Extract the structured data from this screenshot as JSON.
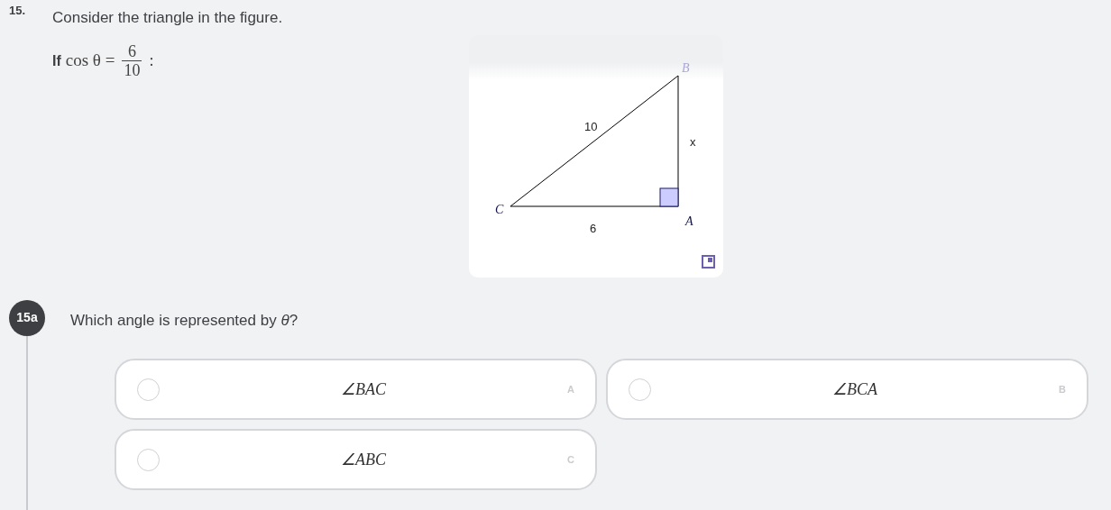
{
  "question": {
    "number": "15.",
    "text": "Consider the triangle in the figure.",
    "condition": {
      "prefix": "If",
      "expression": "cos θ =",
      "numerator": "6",
      "denominator": "10",
      "suffix": ":"
    }
  },
  "figure": {
    "labels": [
      {
        "kind": "vertex",
        "text": "B",
        "muted": true
      },
      {
        "kind": "side",
        "text": "10",
        "muted": false
      },
      {
        "kind": "side",
        "text": "x",
        "muted": false
      },
      {
        "kind": "vertex",
        "text": "C",
        "muted": false
      },
      {
        "kind": "side",
        "text": "6",
        "muted": false
      },
      {
        "kind": "vertex",
        "text": "A",
        "muted": false
      }
    ]
  },
  "part": {
    "badge": "15a",
    "prompt": "Which angle is represented by *θ*?",
    "options": [
      {
        "text": "∠BAC",
        "letter": "A",
        "selected": false
      },
      {
        "text": "∠BCA",
        "letter": "B",
        "selected": false
      },
      {
        "text": "∠ABC",
        "letter": "C",
        "selected": false
      }
    ]
  }
}
